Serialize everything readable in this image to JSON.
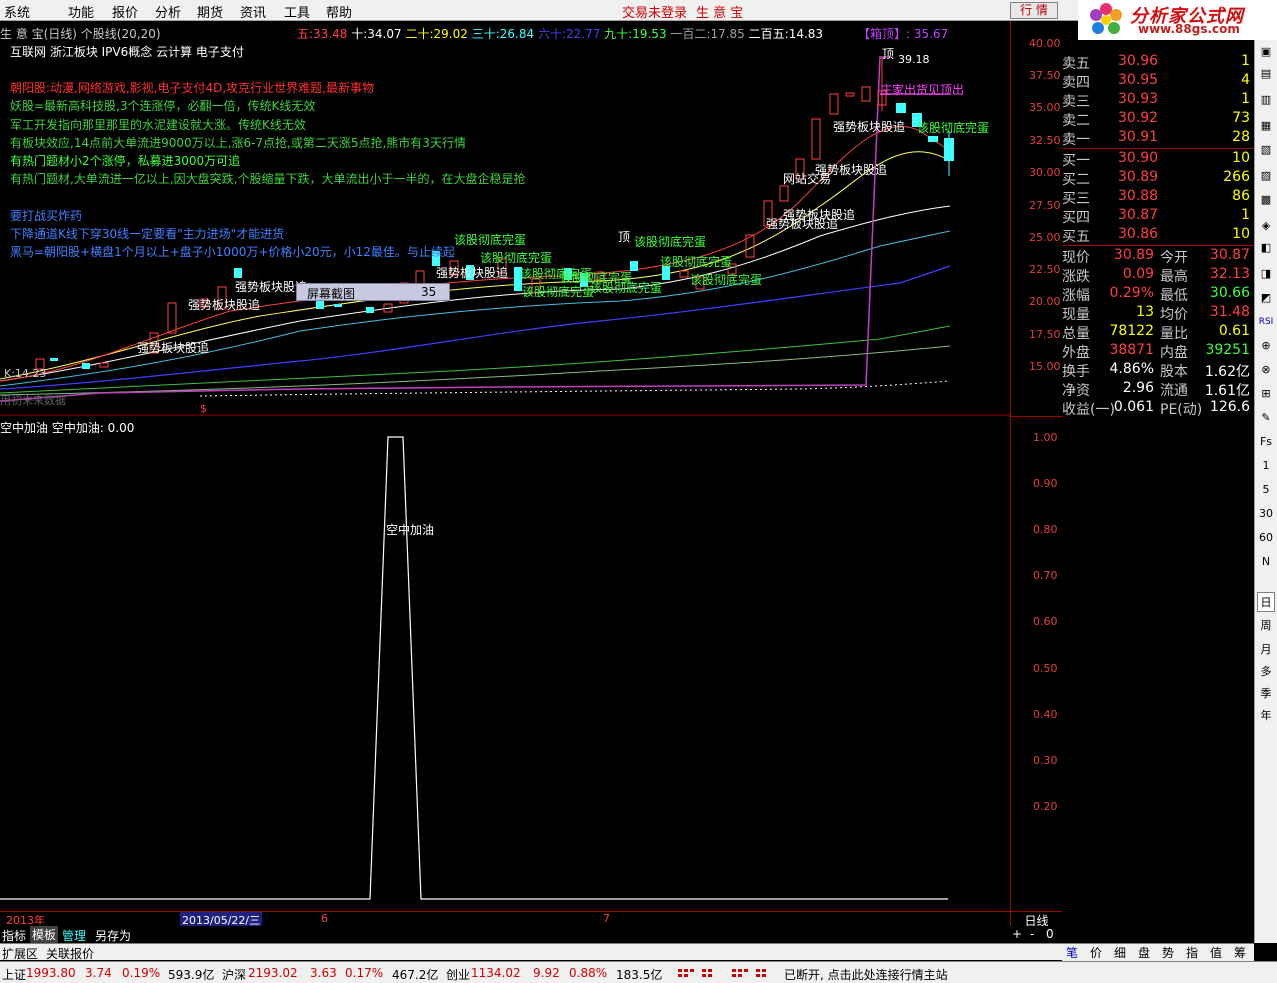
{
  "menu": {
    "items": [
      "系统",
      "功能",
      "报价",
      "分析",
      "期货",
      "资讯",
      "工具",
      "帮助"
    ],
    "center_status": "交易未登录",
    "center_app": "生 意 宝",
    "hq_btn": "行 情"
  },
  "logo": {
    "title": "分析家公式网",
    "url": "www.88gs.com"
  },
  "header": {
    "title": "生 意 宝(日线) 个股线(20,20)",
    "ma": [
      {
        "label": "五:",
        "value": "33.48",
        "color": "#ff4040"
      },
      {
        "label": "十:",
        "value": "34.07",
        "color": "#ffffff"
      },
      {
        "label": "二十:",
        "value": "29.02",
        "color": "#ffff00"
      },
      {
        "label": "三十:",
        "value": "26.84",
        "color": "#40ffff"
      },
      {
        "label": "六十:",
        "value": "22.77",
        "color": "#4040ff"
      },
      {
        "label": "九十:",
        "value": "19.53",
        "color": "#40ff40"
      },
      {
        "label": "一百二:",
        "value": "17.85",
        "color": "#a0a0a0"
      },
      {
        "label": "二百五:",
        "value": "14.83",
        "color": "#ffffff"
      }
    ],
    "box_top": "【箱顶】: 35.67"
  },
  "concepts": "互联网 浙江板块 IPV6概念 云计算 电子支付",
  "notes": [
    {
      "text": "朝阳股:动漫,网络游戏,影视,电子支付4D,攻克行业世界难题,最新事物",
      "color": "#ff3030"
    },
    {
      "text": "妖股=最新高科技股,3个连涨停，必翻一倍，传统K线无效",
      "color": "#40d040"
    },
    {
      "text": "军工开发指向那里那里的水泥建设就大涨。传统K线无效",
      "color": "#40d040"
    },
    {
      "text": "有板块效应,14点前大单流进9000万以上,涨6-7点抢,或第二天涨5点抢,熊市有3天行情",
      "color": "#40d040"
    },
    {
      "text": "有热门题材小2个涨停，私募进3000万可追",
      "color": "#40ff40"
    },
    {
      "text": "有热门题材,大单流进一亿以上,因大盘突跌,个股缩量下跌，大单流出小于一半的，在大盘企稳是抢",
      "color": "#40d040"
    },
    {
      "text": "要打战买炸药",
      "color": "#4080ff"
    },
    {
      "text": "下降通道K线下穿30线一定要看\"主力进场\"才能进货",
      "color": "#4080ff"
    },
    {
      "text": "黑马=朝阳股+横盘1个月以上+盘子小1000万+价格小20元，小12最佳。与止续起",
      "color": "#4080ff"
    }
  ],
  "chart_labels": {
    "strong": "强势板块股追",
    "bottom": "该股彻底完蛋",
    "top": "顶",
    "high_price": "39.18",
    "zhuang": "庄家出货见顶出",
    "website": "网站交易",
    "k_label": "K:14.23",
    "future": "用初未来数据",
    "dollar": "$",
    "screenshot": "屏幕截图",
    "screenshot_val": "35"
  },
  "indicator": {
    "title": "空中加油 空中加油: 0.00",
    "peak_label": "空中加油"
  },
  "price_axis": [
    "40.00",
    "37.50",
    "35.00",
    "32.50",
    "30.00",
    "27.50",
    "25.00",
    "22.50",
    "20.00",
    "17.50",
    "15.00"
  ],
  "ind_axis": [
    "1.00",
    "0.90",
    "0.80",
    "0.70",
    "0.60",
    "0.50",
    "0.40",
    "0.30",
    "0.20"
  ],
  "time_axis": {
    "year": "2013年",
    "date": "2013/05/22/三",
    "m6": "6",
    "m7": "7",
    "period": "日线"
  },
  "quote": {
    "asks": [
      {
        "l": "卖五",
        "p": "30.96",
        "n": "1"
      },
      {
        "l": "卖四",
        "p": "30.95",
        "n": "4"
      },
      {
        "l": "卖三",
        "p": "30.93",
        "n": "1"
      },
      {
        "l": "卖二",
        "p": "30.92",
        "n": "73"
      },
      {
        "l": "卖一",
        "p": "30.91",
        "n": "28"
      }
    ],
    "bids": [
      {
        "l": "买一",
        "p": "30.90",
        "n": "10"
      },
      {
        "l": "买二",
        "p": "30.89",
        "n": "266"
      },
      {
        "l": "买三",
        "p": "30.88",
        "n": "86"
      },
      {
        "l": "买四",
        "p": "30.87",
        "n": "1"
      },
      {
        "l": "买五",
        "p": "30.86",
        "n": "10"
      }
    ],
    "stats": [
      {
        "l1": "现价",
        "v1": "30.89",
        "c1": "#ff4040",
        "l2": "今开",
        "v2": "30.87",
        "c2": "#ff4040"
      },
      {
        "l1": "涨跌",
        "v1": "0.09",
        "c1": "#ff4040",
        "l2": "最高",
        "v2": "32.13",
        "c2": "#ff4040"
      },
      {
        "l1": "涨幅",
        "v1": "0.29%",
        "c1": "#ff4040",
        "l2": "最低",
        "v2": "30.66",
        "c2": "#40ff40"
      },
      {
        "l1": "现量",
        "v1": "13",
        "c1": "#ffff00",
        "l2": "均价",
        "v2": "31.48",
        "c2": "#ff4040"
      },
      {
        "l1": "总量",
        "v1": "78122",
        "c1": "#ffff00",
        "l2": "量比",
        "v2": "0.61",
        "c2": "#ffff00"
      },
      {
        "l1": "外盘",
        "v1": "38871",
        "c1": "#ff4040",
        "l2": "内盘",
        "v2": "39251",
        "c2": "#40ff40"
      },
      {
        "l1": "换手",
        "v1": "4.86%",
        "c1": "#ffffff",
        "l2": "股本",
        "v2": "1.62亿",
        "c2": "#ffffff"
      },
      {
        "l1": "净资",
        "v1": "2.96",
        "c1": "#ffffff",
        "l2": "流通",
        "v2": "1.61亿",
        "c2": "#ffffff"
      },
      {
        "l1": "收益(一)",
        "v1": "0.061",
        "c1": "#ffffff",
        "l2": "PE(动)",
        "v2": "126.6",
        "c2": "#ffffff"
      }
    ]
  },
  "sidebar": [
    "Fs",
    "1",
    "5",
    "30",
    "60",
    "N",
    "日",
    "周",
    "月",
    "多",
    "季",
    "年"
  ],
  "tabs": {
    "a": "指标",
    "b": "模板",
    "c": "管理",
    "d": "另存为",
    "e": "扩展区",
    "f": "关联报价",
    "plus": "+",
    "minus": "-",
    "zero": "0"
  },
  "right_tabs": [
    "笔",
    "价",
    "细",
    "盘",
    "势",
    "指",
    "值",
    "筹"
  ],
  "status": {
    "sh_label": "上证",
    "sh_val": "1993.80",
    "sh_chg": "3.74",
    "sh_pct": "0.19%",
    "sh_amt": "593.9亿",
    "hs_label": "沪深",
    "hs_val": "2193.02",
    "hs_chg": "3.63",
    "hs_pct": "0.17%",
    "hs_amt": "467.2亿",
    "cy_label": "创业",
    "cy_val": "1134.02",
    "cy_chg": "9.92",
    "cy_pct": "0.88%",
    "cy_amt": "183.5亿",
    "conn": "已断开, 点击此处连接行情主站"
  }
}
